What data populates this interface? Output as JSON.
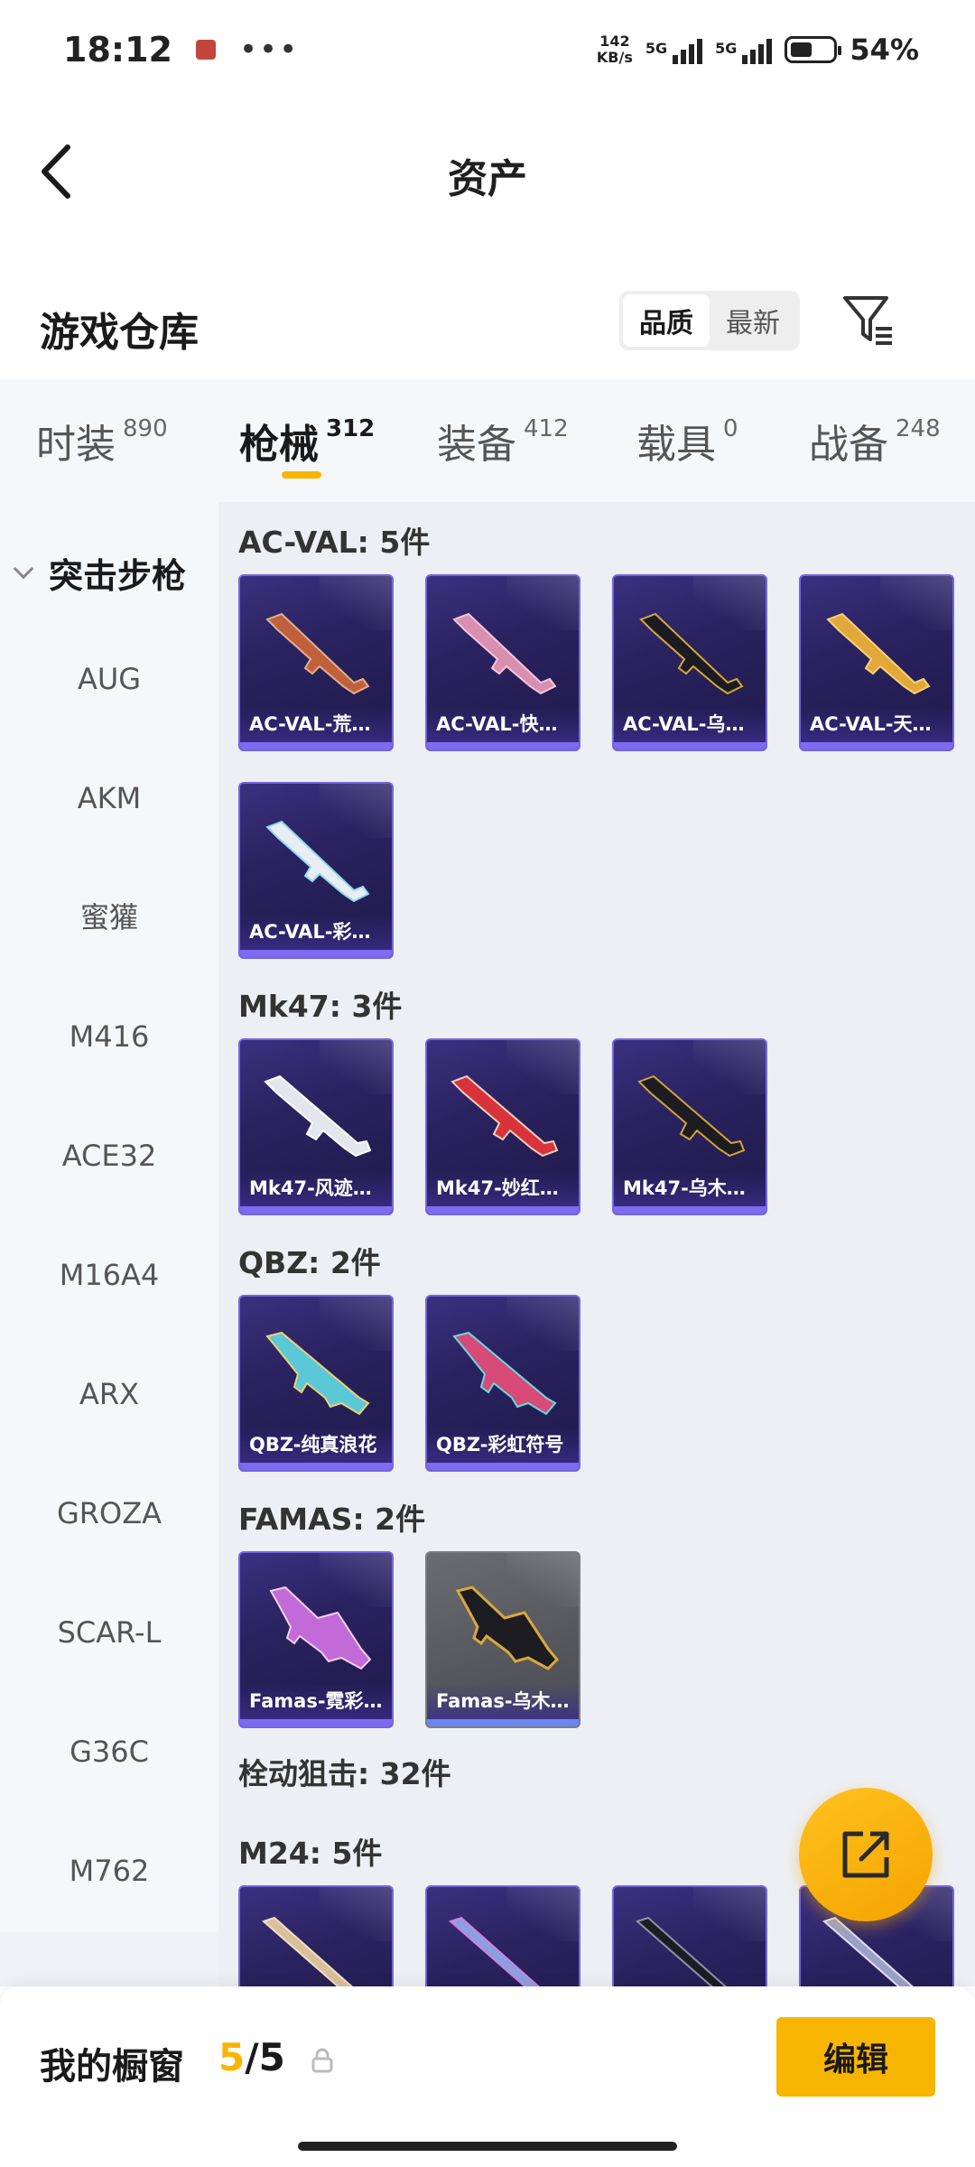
{
  "status_bar": {
    "time": "18:12",
    "dots": "•••",
    "speed_value": "142",
    "speed_unit": "KB/s",
    "net1": "5G",
    "net2": "5G",
    "battery": "54%",
    "battery_level": 0.54
  },
  "header": {
    "title": "资产"
  },
  "warehouse": {
    "title": "游戏仓库",
    "sort_quality": "品质",
    "sort_newest": "最新"
  },
  "tabs": [
    {
      "label": "时装",
      "count": "890"
    },
    {
      "label": "枪械",
      "count": "312"
    },
    {
      "label": "装备",
      "count": "412"
    },
    {
      "label": "载具",
      "count": "0"
    },
    {
      "label": "战备",
      "count": "248"
    }
  ],
  "sidebar": {
    "group": "突击步枪",
    "items": [
      "AUG",
      "AKM",
      "蜜獾",
      "M416",
      "ACE32",
      "M16A4",
      "ARX",
      "GROZA",
      "SCAR-L",
      "G36C",
      "M762"
    ]
  },
  "sections": [
    {
      "title": "AC-VAL: 5件",
      "cards": [
        "AC-VAL-荒…",
        "AC-VAL-快…",
        "AC-VAL-乌…",
        "AC-VAL-天…",
        "AC-VAL-彩…"
      ]
    },
    {
      "title": "Mk47: 3件",
      "cards": [
        "Mk47-风迹…",
        "Mk47-妙红…",
        "Mk47-乌木…"
      ]
    },
    {
      "title": "QBZ: 2件",
      "cards": [
        "QBZ-纯真浪花",
        "QBZ-彩虹符号"
      ]
    },
    {
      "title": "FAMAS: 2件",
      "cards": [
        "Famas-霓彩…",
        "Famas-乌木…"
      ]
    },
    {
      "title": "栓动狙击: 32件"
    },
    {
      "title": "M24: 5件"
    }
  ],
  "bottom": {
    "title": "我的橱窗",
    "current": "5",
    "sep_total": "/5",
    "edit": "编辑"
  }
}
